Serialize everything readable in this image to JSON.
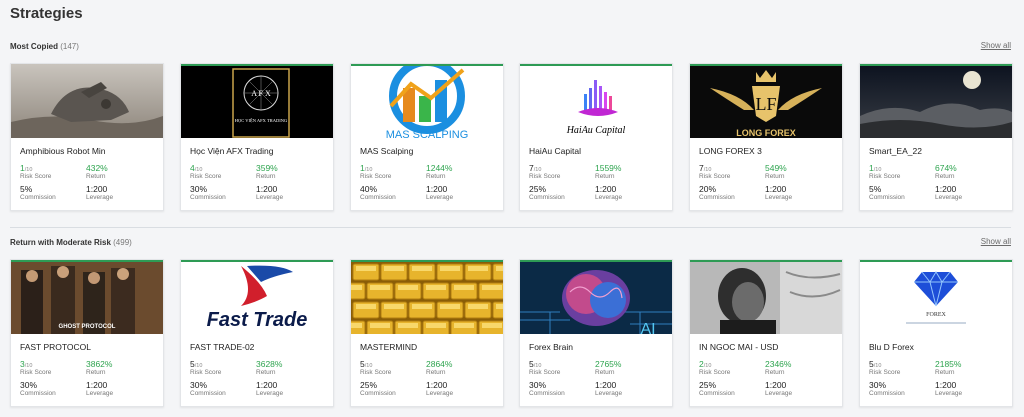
{
  "page": {
    "title": "Strategies"
  },
  "sections": [
    {
      "title": "Most Copied",
      "count": "(147)",
      "show_all": "Show all",
      "cards": [
        {
          "name": "Amphibious Robot Min",
          "risk": "1",
          "risk_green": true,
          "return": "432%",
          "commission": "5%",
          "leverage": "1:200",
          "image": "robot-landscape-image"
        },
        {
          "name": "Học Viện AFX Trading",
          "risk": "4",
          "risk_green": true,
          "return": "359%",
          "commission": "30%",
          "leverage": "1:200",
          "image": "afx-logo-image",
          "logo_text": "HỌC VIỆN AFX TRADING"
        },
        {
          "name": "MAS Scalping",
          "risk": "1",
          "risk_green": true,
          "return": "1244%",
          "commission": "40%",
          "leverage": "1:200",
          "image": "mas-scalping-logo",
          "logo_text": "MAS SCALPING"
        },
        {
          "name": "HaiAu Capital",
          "risk": "7",
          "risk_green": false,
          "return": "1559%",
          "commission": "25%",
          "leverage": "1:200",
          "image": "haiau-capital-logo",
          "logo_text": "HaiAu Capital"
        },
        {
          "name": "LONG FOREX 3",
          "risk": "7",
          "risk_green": false,
          "return": "549%",
          "commission": "20%",
          "leverage": "1:200",
          "image": "long-forex-logo",
          "logo_text": "LONG FOREX"
        },
        {
          "name": "Smart_EA_22",
          "risk": "1",
          "risk_green": true,
          "return": "674%",
          "commission": "5%",
          "leverage": "1:200",
          "image": "night-sky-moon-image"
        }
      ]
    },
    {
      "title": "Return with Moderate Risk",
      "count": "(499)",
      "show_all": "Show all",
      "cards": [
        {
          "name": "FAST PROTOCOL",
          "risk": "3",
          "risk_green": true,
          "return": "3862%",
          "commission": "30%",
          "leverage": "1:200",
          "image": "movie-poster-image",
          "logo_text": "GHOST PROTOCOL"
        },
        {
          "name": "FAST TRADE-02",
          "risk": "5",
          "risk_green": false,
          "return": "3628%",
          "commission": "30%",
          "leverage": "1:200",
          "image": "fast-trade-logo",
          "logo_text": "Fast Trade"
        },
        {
          "name": "MASTERMIND",
          "risk": "5",
          "risk_green": false,
          "return": "2864%",
          "commission": "25%",
          "leverage": "1:200",
          "image": "gold-bars-image"
        },
        {
          "name": "Forex Brain",
          "risk": "5",
          "risk_green": false,
          "return": "2765%",
          "commission": "30%",
          "leverage": "1:200",
          "image": "ai-brain-image",
          "logo_text": "AI"
        },
        {
          "name": "IN NGOC MAI - USD",
          "risk": "2",
          "risk_green": true,
          "return": "2346%",
          "commission": "25%",
          "leverage": "1:200",
          "image": "bw-portrait-image"
        },
        {
          "name": "Blu D Forex",
          "risk": "5",
          "risk_green": false,
          "return": "2185%",
          "commission": "30%",
          "leverage": "1:200",
          "image": "blue-diamond-logo",
          "logo_text": "FOREX"
        }
      ]
    }
  ],
  "labels": {
    "risk_score": "Risk Score",
    "return": "Return",
    "commission": "Commission",
    "leverage": "Leverage",
    "risk_suffix": "/10"
  },
  "colors": {
    "green": "#2ea44f",
    "accent_top": "#2e9b55",
    "background": "#f4f5f7"
  }
}
